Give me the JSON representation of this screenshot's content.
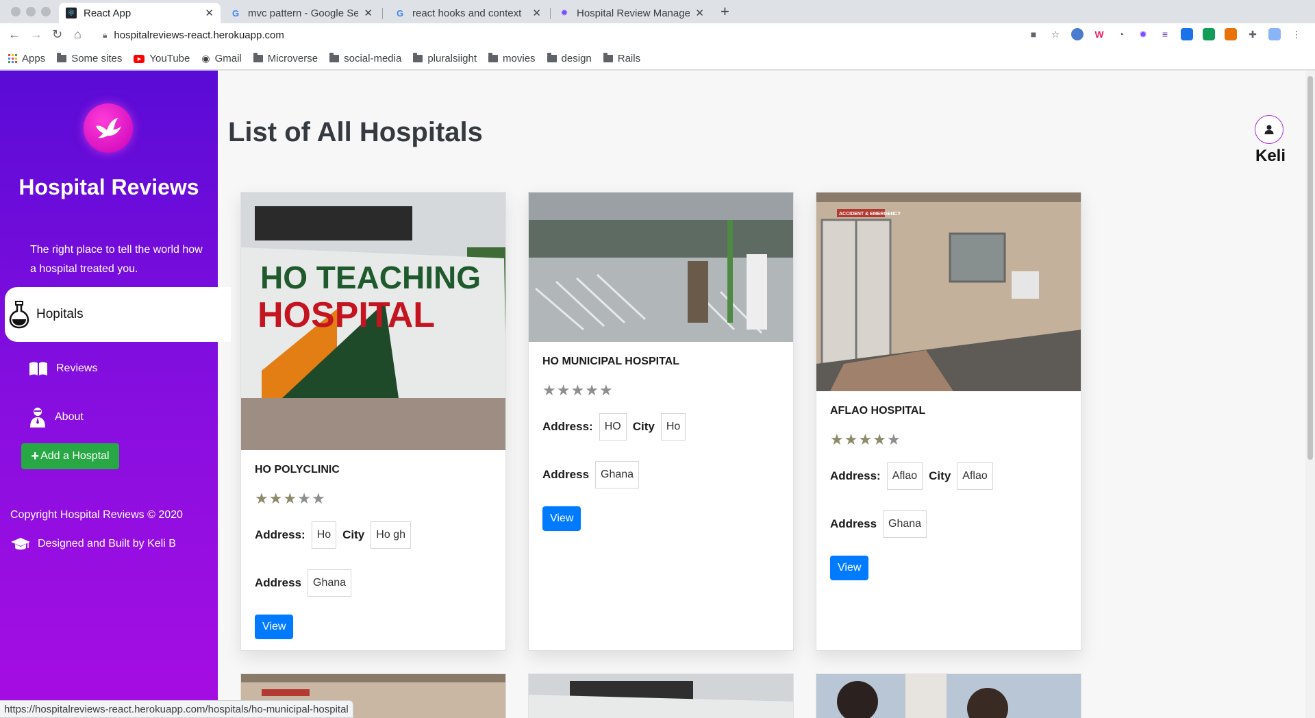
{
  "browser": {
    "tabs": [
      {
        "title": "React App",
        "active": true,
        "favicon": "react-favicon"
      },
      {
        "title": "mvc pattern - Google Sea",
        "active": false,
        "favicon": "google-favicon"
      },
      {
        "title": "react hooks and context",
        "active": false,
        "favicon": "google-favicon"
      },
      {
        "title": "Hospital Review Manage",
        "active": false,
        "favicon": "hospital-favicon"
      }
    ],
    "url": "hospitalreviews-react.herokuapp.com",
    "bookmarks": [
      "Apps",
      "Some sites",
      "YouTube",
      "Gmail",
      "Microverse",
      "social-media",
      "pluralsiight",
      "movies",
      "design",
      "Rails"
    ],
    "status_url": "https://hospitalreviews-react.herokuapp.com/hospitals/ho-municipal-hospital"
  },
  "sidebar": {
    "brand": "Hospital Reviews",
    "tagline": "The right place to tell the world how a hospital treated you.",
    "nav": {
      "hospitals": "Hopitals",
      "reviews": "Reviews",
      "about": "About"
    },
    "add_button": "Add a Hosptal",
    "copyright": "Copyright Hospital Reviews © 2020",
    "designed": "Designed and Built by Keli B"
  },
  "main": {
    "title": "List of All Hospitals",
    "user": "Keli",
    "labels": {
      "address": "Address:",
      "city": "City",
      "country": "Address",
      "view": "View"
    },
    "hospitals": [
      {
        "name": "HO POLYCLINIC",
        "rating": 4,
        "address": "Ho",
        "city": "Ho gh",
        "country": "Ghana",
        "image_text": [
          "HO TEACHING",
          "HOSPITAL"
        ]
      },
      {
        "name": "HO MUNICIPAL HOSPITAL",
        "rating": 0,
        "address": "HO",
        "city": "Ho",
        "country": "Ghana"
      },
      {
        "name": "AFLAO HOSPITAL",
        "rating": 4,
        "address": "Aflao",
        "city": "Aflao",
        "country": "Ghana",
        "image_text": [
          "ACCIDENT & EMERGENCY"
        ]
      }
    ]
  },
  "colors": {
    "sidebar_top": "#5a0bd6",
    "sidebar_bottom": "#a60de2",
    "add_button": "#28a745",
    "view_button": "#007bff",
    "logo": "#d400c4"
  }
}
